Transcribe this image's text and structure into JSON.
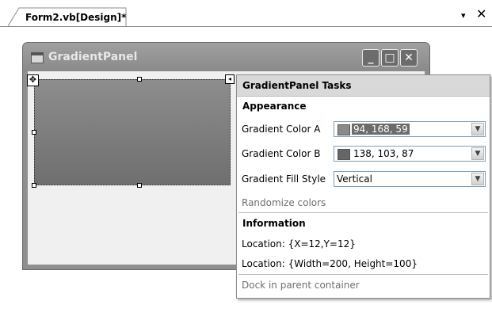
{
  "document_tab": {
    "title": "Form2.vb[Design]*",
    "dropdown_glyph": "▾",
    "close_glyph": "✕"
  },
  "form": {
    "title": "GradientPanel",
    "caption_buttons": {
      "minimize": "_",
      "maximize": "□",
      "close": "✕"
    }
  },
  "tasks_panel": {
    "title": "GradientPanel Tasks",
    "appearance_header": "Appearance",
    "gradient_color_a": {
      "label": "Gradient Color A",
      "value": "94, 168, 59",
      "swatch": "#8a8a8a"
    },
    "gradient_color_b": {
      "label": "Gradient Color B",
      "value": "138, 103, 87",
      "swatch": "#666666"
    },
    "gradient_fill_style": {
      "label": "Gradient Fill Style",
      "value": "Vertical"
    },
    "randomize_link": "Randomize colors",
    "information_header": "Information",
    "location_text": "Location: {X=12,Y=12}",
    "size_text": "Location: {Width=200, Height=100}",
    "dock_link": "Dock in parent container"
  }
}
